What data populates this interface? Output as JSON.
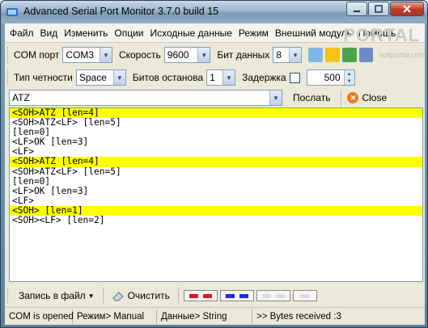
{
  "window": {
    "title": "Advanced Serial Port Monitor 3.7.0 build 15",
    "watermark": "PORTAL",
    "watermark_sub": "softportal.com"
  },
  "menu": [
    "Файл",
    "Вид",
    "Изменить",
    "Опции",
    "Исходные данные",
    "Режим",
    "Внешний модуль",
    "Помощь"
  ],
  "toolbar1": {
    "com_label": "COM порт",
    "com_value": "COM3",
    "speed_label": "Скорость",
    "speed_value": "9600",
    "databits_label": "Бит данных",
    "databits_value": "8"
  },
  "toolbar2": {
    "parity_label": "Тип четности",
    "parity_value": "Space",
    "stopbits_label": "Битов останова",
    "stopbits_value": "1",
    "delay_label": "Задержка",
    "delay_checked": false,
    "delay_value": "500"
  },
  "send": {
    "input_value": "ATZ",
    "send_label": "Послать",
    "close_label": "Close"
  },
  "log": [
    {
      "text": "<SOH>ATZ [len=4]",
      "highlight": true
    },
    {
      "text": "<SOH>ATZ<LF> [len=5]",
      "highlight": false
    },
    {
      "text": "[len=0]",
      "highlight": false
    },
    {
      "text": "<LF>OK [len=3]",
      "highlight": false
    },
    {
      "text": "<LF>",
      "highlight": false
    },
    {
      "text": "<SOH>ATZ [len=4]",
      "highlight": true
    },
    {
      "text": "<SOH>ATZ<LF> [len=5]",
      "highlight": false
    },
    {
      "text": "[len=0]",
      "highlight": false
    },
    {
      "text": "<LF>OK [len=3]",
      "highlight": false
    },
    {
      "text": "<LF>",
      "highlight": false
    },
    {
      "text": "<SOH> [len=1]",
      "highlight": true
    },
    {
      "text": "<SOH><LF> [len=2]",
      "highlight": false
    }
  ],
  "bottom": {
    "save_label": "Запись в файл",
    "clear_label": "Очистить"
  },
  "status": {
    "port": "COM is opened",
    "mode": "Режим> Manual",
    "data": "Данные> String",
    "bytes": ">> Bytes received :3"
  },
  "colors": {
    "highlight": "#ffff00",
    "swatch_red": "#e8141c",
    "swatch_blue": "#1d2cd6"
  }
}
